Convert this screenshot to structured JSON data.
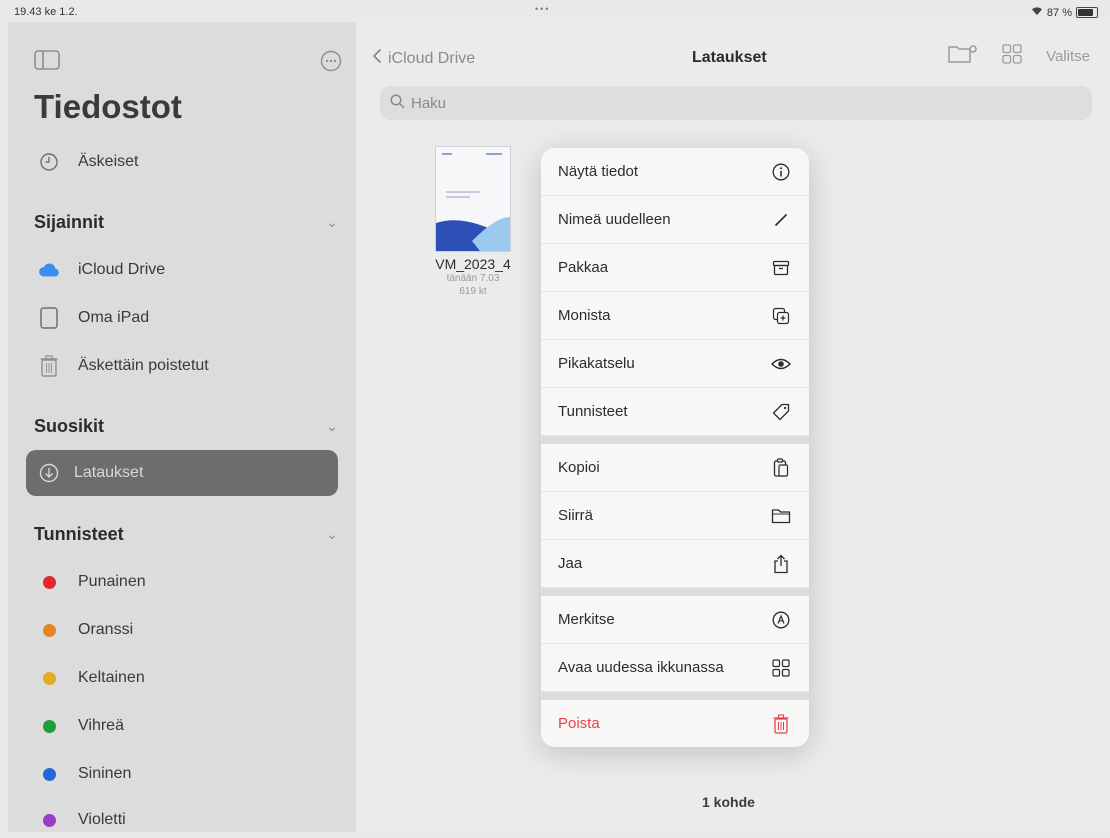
{
  "status": {
    "time": "19.43",
    "date": "ke 1.2.",
    "battery": "87 %"
  },
  "sidebar": {
    "title": "Tiedostot",
    "recent": "Äskeiset",
    "locations_header": "Sijainnit",
    "locations": [
      {
        "label": "iCloud Drive",
        "icon": "cloud-icon"
      },
      {
        "label": "Oma iPad",
        "icon": "ipad-icon"
      },
      {
        "label": "Äskettäin poistetut",
        "icon": "trash-icon"
      }
    ],
    "favorites_header": "Suosikit",
    "favorites": [
      {
        "label": "Lataukset",
        "icon": "download-icon"
      }
    ],
    "tags_header": "Tunnisteet",
    "tags": [
      {
        "label": "Punainen",
        "color": "#e0282e"
      },
      {
        "label": "Oranssi",
        "color": "#e58423"
      },
      {
        "label": "Keltainen",
        "color": "#e3ab22"
      },
      {
        "label": "Vihreä",
        "color": "#1e9e3a"
      },
      {
        "label": "Sininen",
        "color": "#2567d8"
      },
      {
        "label": "Violetti",
        "color": "#9a3cc4"
      }
    ]
  },
  "main": {
    "back_label": "iCloud Drive",
    "title": "Lataukset",
    "select_label": "Valitse",
    "search_placeholder": "Haku",
    "file": {
      "name": "VM_2023_4",
      "date": "tänään 7.03",
      "size": "619 kt"
    },
    "count": "1 kohde"
  },
  "menu": {
    "group1": [
      {
        "label": "Näytä tiedot",
        "icon": "info-icon"
      },
      {
        "label": "Nimeä uudelleen",
        "icon": "pencil-icon"
      },
      {
        "label": "Pakkaa",
        "icon": "archive-icon"
      },
      {
        "label": "Monista",
        "icon": "duplicate-icon"
      },
      {
        "label": "Pikakatselu",
        "icon": "eye-icon"
      },
      {
        "label": "Tunnisteet",
        "icon": "tag-icon"
      }
    ],
    "group2": [
      {
        "label": "Kopioi",
        "icon": "copy-icon"
      },
      {
        "label": "Siirrä",
        "icon": "folder-icon"
      },
      {
        "label": "Jaa",
        "icon": "share-icon"
      }
    ],
    "group3": [
      {
        "label": "Merkitse",
        "icon": "markup-icon"
      },
      {
        "label": "Avaa uudessa ikkunassa",
        "icon": "grid-icon"
      }
    ],
    "group4": [
      {
        "label": "Poista",
        "icon": "trash-icon"
      }
    ]
  }
}
